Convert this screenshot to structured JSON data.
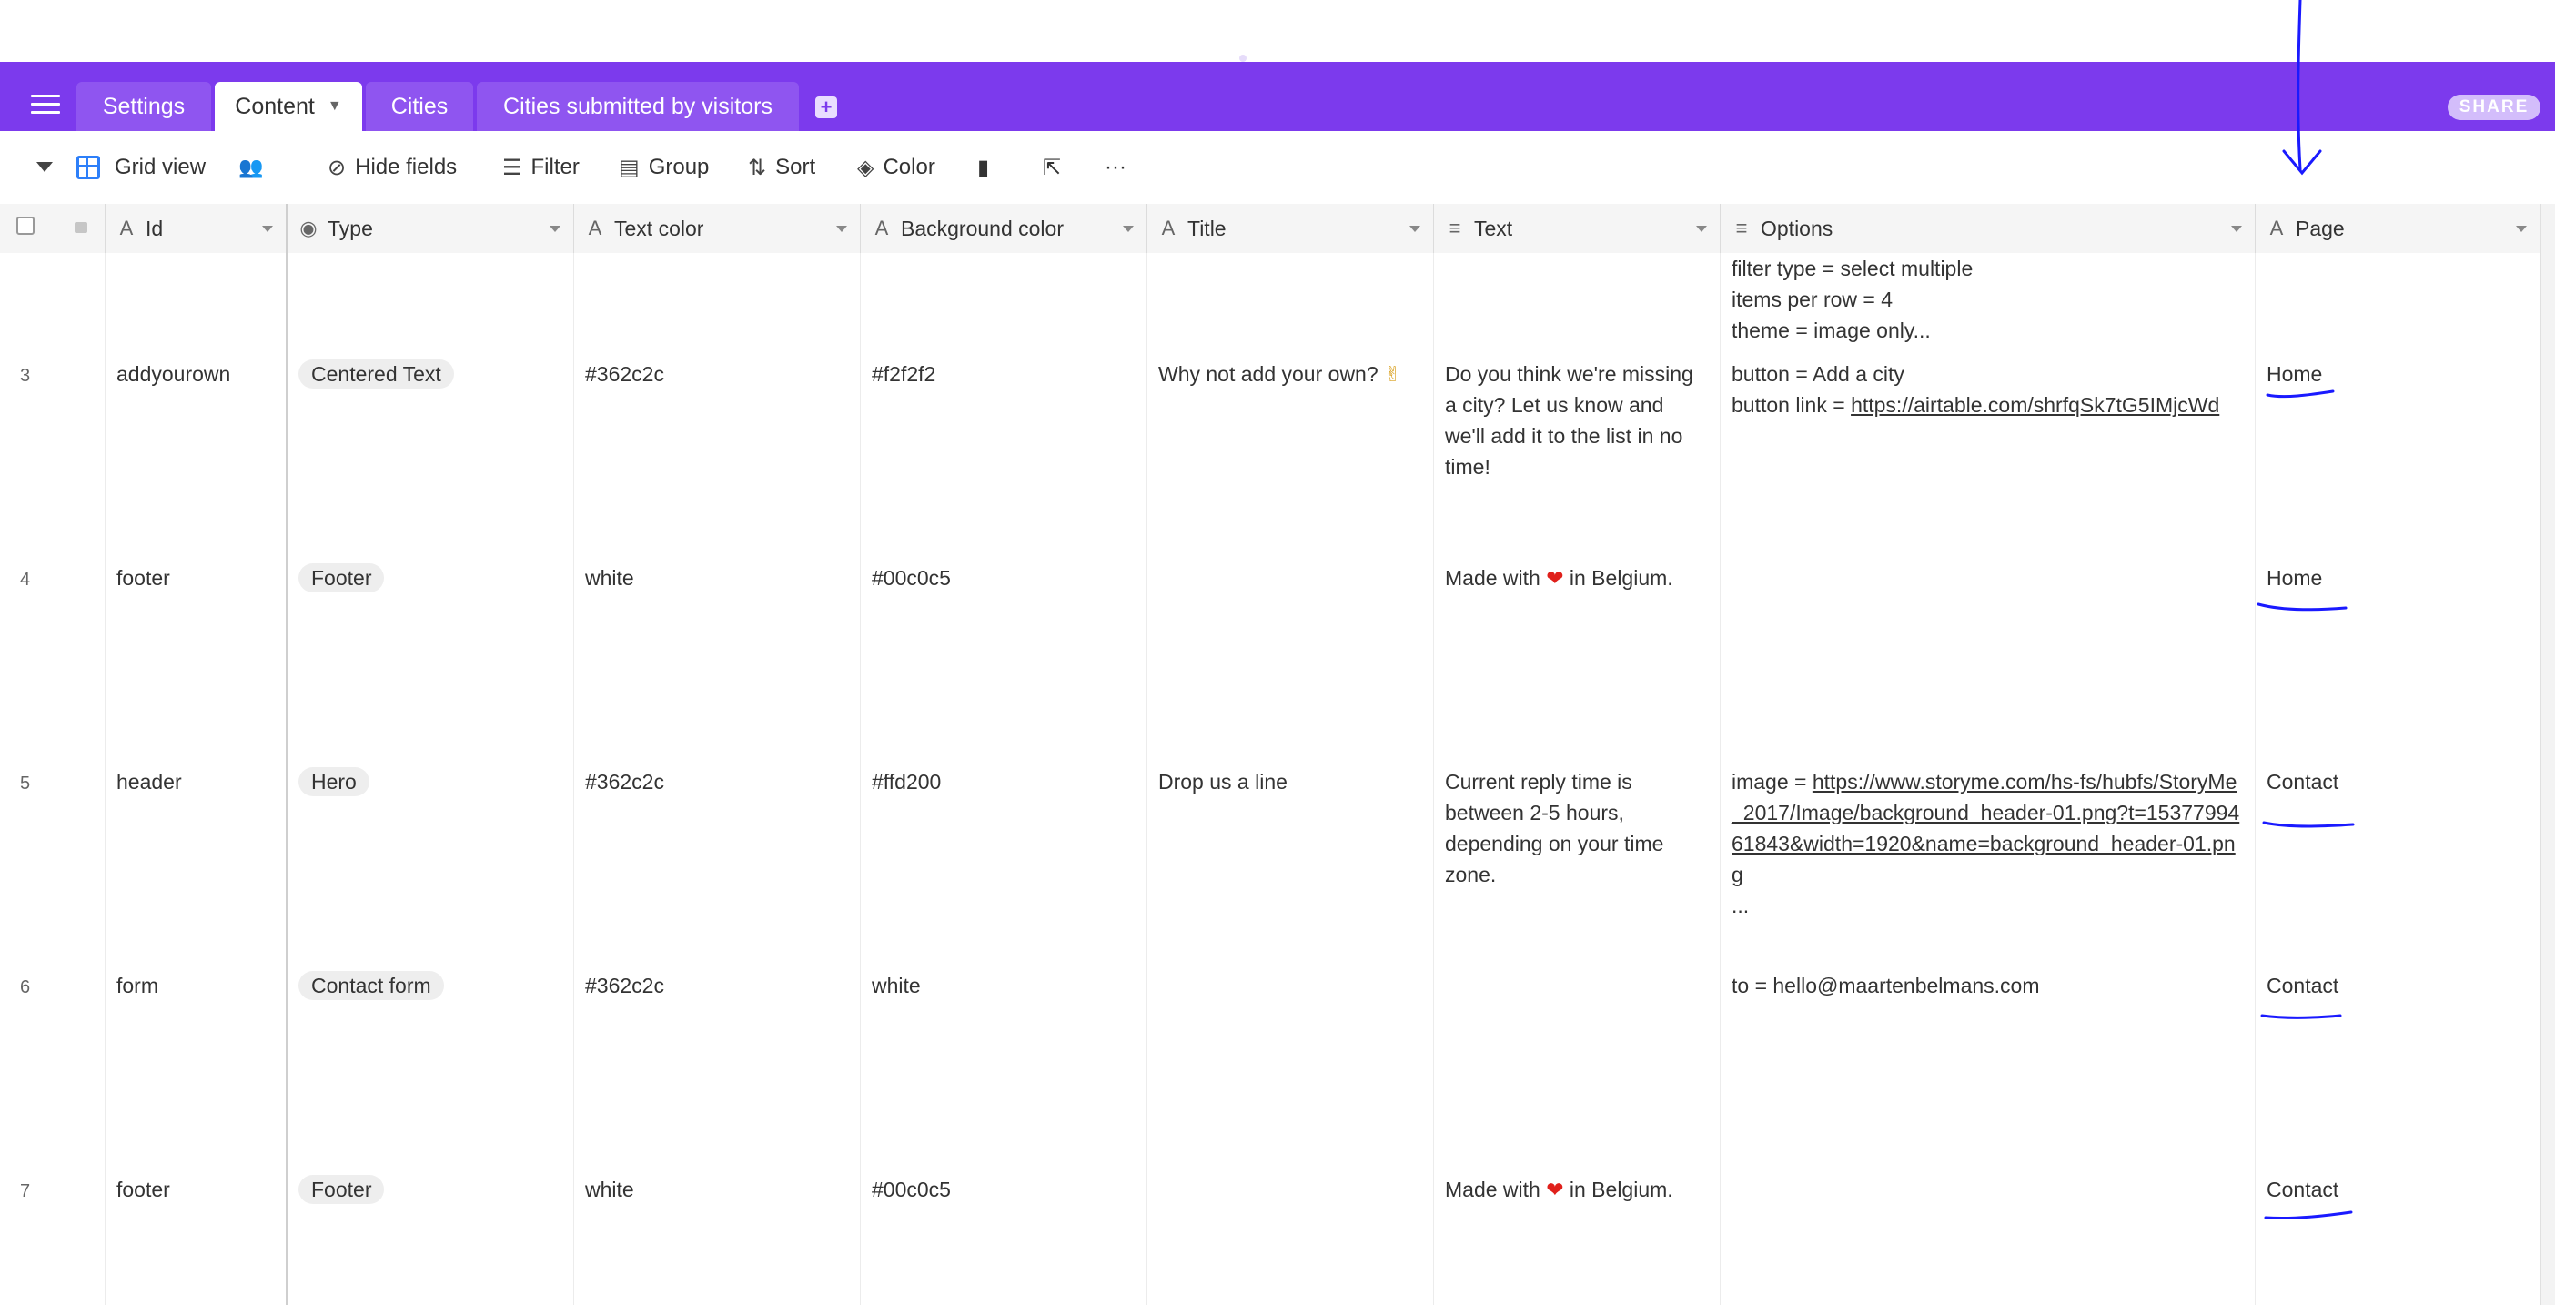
{
  "tabs": [
    {
      "label": "Settings",
      "active": false
    },
    {
      "label": "Content",
      "active": true
    },
    {
      "label": "Cities",
      "active": false
    },
    {
      "label": "Cities submitted by visitors",
      "active": false
    }
  ],
  "share_label": "SHARE",
  "toolbar": {
    "view_name": "Grid view",
    "hide_fields": "Hide fields",
    "filter": "Filter",
    "group": "Group",
    "sort": "Sort",
    "color": "Color",
    "more": "···"
  },
  "columns": {
    "id": "Id",
    "type": "Type",
    "text_color": "Text color",
    "background_color": "Background color",
    "title": "Title",
    "text": "Text",
    "options": "Options",
    "page": "Page"
  },
  "partial_row": {
    "options": [
      "filter type = select multiple",
      "items per row = 4",
      "theme = image only..."
    ]
  },
  "rows": [
    {
      "num": "3",
      "id": "addyourown",
      "type": "Centered Text",
      "text_color": "#362c2c",
      "background_color": "#f2f2f2",
      "title": "Why not add your own?",
      "text": "Do you think we're missing a city? Let us know and we'll add it to the list in no time!",
      "options": [
        "button = Add a city",
        "button link = "
      ],
      "options_link": "https://airtable.com/shrfqSk7tG5IMjcWd",
      "page": "Home"
    },
    {
      "num": "4",
      "id": "footer",
      "type": "Footer",
      "text_color": "white",
      "background_color": "#00c0c5",
      "title": "",
      "text_before": "Made with",
      "text_heart": "❤",
      "text_after": "in Belgium.",
      "page": "Home"
    },
    {
      "num": "5",
      "id": "header",
      "type": "Hero",
      "text_color": "#362c2c",
      "background_color": "#ffd200",
      "title": "Drop us a line",
      "text": "Current reply time is between 2-5 hours, depending on your time zone.",
      "options_prefix": "image = ",
      "options_link": "https://www.storyme.com/hs-fs/hubfs/StoryMe_2017/Image/background_header-01.png?t=1537799461843&width=1920&name=background_header-01.png",
      "options_more": "...",
      "page": "Contact"
    },
    {
      "num": "6",
      "id": "form",
      "type": "Contact form",
      "text_color": "#362c2c",
      "background_color": "white",
      "title": "",
      "options": [
        "to = hello@maartenbelmans.com"
      ],
      "page": "Contact"
    },
    {
      "num": "7",
      "id": "footer",
      "type": "Footer",
      "text_color": "white",
      "background_color": "#00c0c5",
      "title": "",
      "text_before": "Made with",
      "text_heart": "❤",
      "text_after": "in Belgium.",
      "page": "Contact"
    }
  ],
  "colors": {
    "tabbar": "#7c3aed",
    "grid_icon": "#2d7ff9",
    "annotation": "#1a1aff"
  }
}
